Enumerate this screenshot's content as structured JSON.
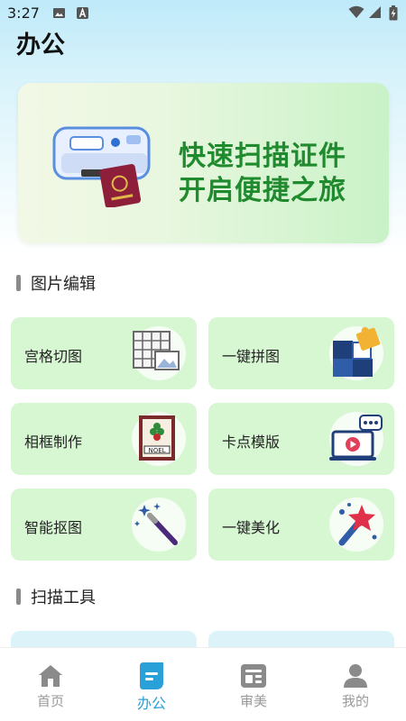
{
  "status_bar": {
    "time": "3:27",
    "icons": [
      "image-icon",
      "text-a-icon",
      "wifi-icon",
      "signal-icon",
      "battery-charging-icon"
    ]
  },
  "page": {
    "title": "办公"
  },
  "banner": {
    "line1": "快速扫描证件",
    "line2": "开启便捷之旅",
    "accent_color": "#1f8a2e"
  },
  "sections": [
    {
      "title": "图片编辑",
      "tiles": [
        {
          "label": "宫格切图",
          "icon": "grid-cut-icon"
        },
        {
          "label": "一键拼图",
          "icon": "puzzle-icon"
        },
        {
          "label": "相框制作",
          "icon": "photo-frame-icon"
        },
        {
          "label": "卡点模版",
          "icon": "video-template-icon"
        },
        {
          "label": "智能抠图",
          "icon": "magic-wand-icon"
        },
        {
          "label": "一键美化",
          "icon": "beautify-wand-icon"
        }
      ]
    },
    {
      "title": "扫描工具",
      "tiles": []
    }
  ],
  "bottom_nav": {
    "items": [
      {
        "label": "首页",
        "icon": "home-icon",
        "active": false
      },
      {
        "label": "办公",
        "icon": "office-doc-icon",
        "active": true
      },
      {
        "label": "审美",
        "icon": "aesthetic-news-icon",
        "active": false
      },
      {
        "label": "我的",
        "icon": "profile-icon",
        "active": false
      }
    ],
    "active_color": "#2aa0d8",
    "inactive_color": "#9a9a9a"
  },
  "colors": {
    "tile_background": "#d7f7d3",
    "header_gradient_top": "#bfeaf9"
  }
}
